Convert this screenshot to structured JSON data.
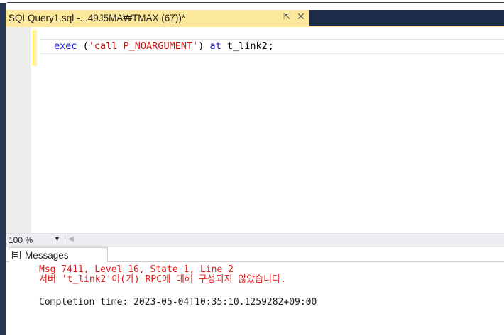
{
  "document_tab": {
    "title": "SQLQuery1.sql -...49J5MA₩TMAX (67))*",
    "pin_glyph": "⇱",
    "close_glyph": "✕"
  },
  "editor": {
    "tokens": {
      "exec": "exec",
      "open_paren": " (",
      "string": "'call P_NOARGUMENT'",
      "close_paren": ") ",
      "at": "at",
      "target_before_caret": " t_link2",
      "target_after_caret": ";"
    }
  },
  "zoom": {
    "value": "100 %",
    "dropdown_glyph": "▼",
    "scroll_left_glyph": "◀"
  },
  "results": {
    "tab_label": "Messages",
    "lines": {
      "error_1": "Msg 7411, Level 16, State 1, Line 2",
      "error_2": "서버 't_link2'이(가) RPC에 대해 구성되지 않았습니다.",
      "completion": "Completion time: 2023-05-04T10:35:10.1259282+09:00"
    }
  },
  "colors": {
    "tab_active": "#fce89a",
    "tab_bar": "#1c2b47",
    "keyword": "#1515d8",
    "string": "#d01010",
    "error_text": "#e01b1b"
  }
}
